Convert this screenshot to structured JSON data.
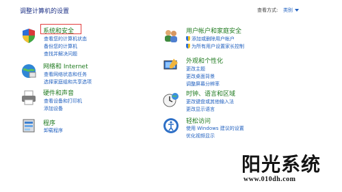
{
  "header": {
    "title": "调整计算机的设置",
    "view_by_label": "查看方式:",
    "view_by_value": "类别"
  },
  "categories": [
    {
      "title": "系统和安全",
      "icon": "security-shield-icon",
      "links": [
        "查看您的计算机状态",
        "备份您的计算机",
        "查找并解决问题"
      ]
    },
    {
      "title": "网络和 Internet",
      "icon": "network-globe-icon",
      "links": [
        "查看网络状态和任务",
        "选择家庭组和共享选项"
      ]
    },
    {
      "title": "硬件和声音",
      "icon": "printer-icon",
      "links": [
        "查看设备和打印机",
        "添加设备"
      ]
    },
    {
      "title": "程序",
      "icon": "programs-icon",
      "links": [
        "卸载程序"
      ]
    },
    {
      "title": "用户帐户和家庭安全",
      "icon": "users-icon",
      "links": [
        "添加或删除用户帐户",
        "为所有用户设置家长控制"
      ]
    },
    {
      "title": "外观和个性化",
      "icon": "appearance-icon",
      "links": [
        "更改主题",
        "更改桌面背景",
        "调整屏幕分辨率"
      ]
    },
    {
      "title": "时钟、语言和区域",
      "icon": "clock-globe-icon",
      "links": [
        "更改键盘或其他输入法",
        "更改显示语言"
      ]
    },
    {
      "title": "轻松访问",
      "icon": "accessibility-icon",
      "links": [
        "使用 Windows 建议的设置",
        "优化视频显示"
      ]
    }
  ],
  "watermark": {
    "brand": "阳光系统",
    "url": "www.010dh.com"
  },
  "colors": {
    "title_blue": "#1e3287",
    "link_blue": "#1f5fbf",
    "category_green": "#1f7a1f",
    "highlight_red": "#e23b3b"
  }
}
